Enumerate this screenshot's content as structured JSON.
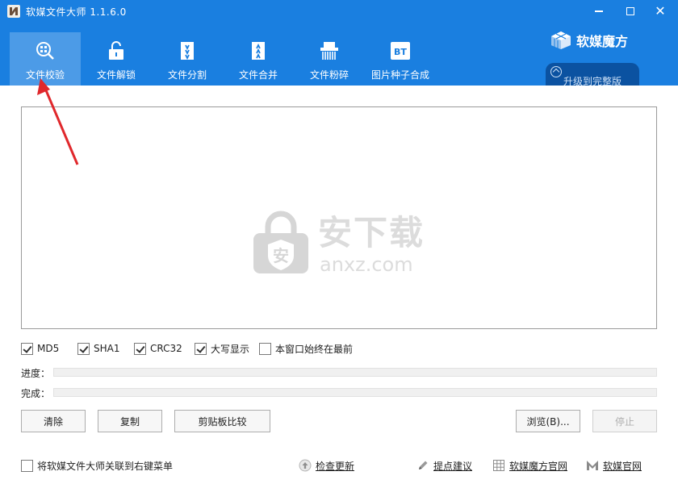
{
  "window": {
    "title": "软媒文件大师 1.1.6.0",
    "close_glyph": "✕"
  },
  "toolbar": {
    "items": [
      {
        "label": "文件校验",
        "icon": "magnify-check-icon",
        "active": true
      },
      {
        "label": "文件解锁",
        "icon": "unlock-icon",
        "active": false
      },
      {
        "label": "文件分割",
        "icon": "file-split-icon",
        "active": false
      },
      {
        "label": "文件合并",
        "icon": "file-merge-icon",
        "active": false
      },
      {
        "label": "文件粉碎",
        "icon": "shredder-icon",
        "active": false
      },
      {
        "label": "图片种子合成",
        "icon": "bt-icon",
        "active": false
      }
    ]
  },
  "brand": {
    "name": "软媒魔方",
    "upgrade_label": "升级到完整版"
  },
  "watermark": {
    "text": "安下载",
    "sub": "anxz.com",
    "lock_char": "安"
  },
  "options": [
    {
      "label": "MD5",
      "checked": true
    },
    {
      "label": "SHA1",
      "checked": true
    },
    {
      "label": "CRC32",
      "checked": true
    },
    {
      "label": "大写显示",
      "checked": true
    },
    {
      "label": "本窗口始终在最前",
      "checked": false
    }
  ],
  "progress": {
    "progress_label": "进度：",
    "done_label": "完成：",
    "progress_value": 0,
    "done_value": 0
  },
  "buttons": {
    "clear": "清除",
    "copy": "复制",
    "clipboard_compare": "剪贴板比较",
    "browse": "浏览(B)...",
    "stop": "停止"
  },
  "footer": {
    "context_menu_label": "将软媒文件大师关联到右键菜单",
    "context_menu_checked": false,
    "check_update": "检查更新",
    "suggest": "提点建议",
    "mofang_site": "软媒魔方官网",
    "ruanmei_site": "软媒官网"
  },
  "colors": {
    "header_blue": "#1a7fe0",
    "arrow_red": "#e0282c"
  }
}
